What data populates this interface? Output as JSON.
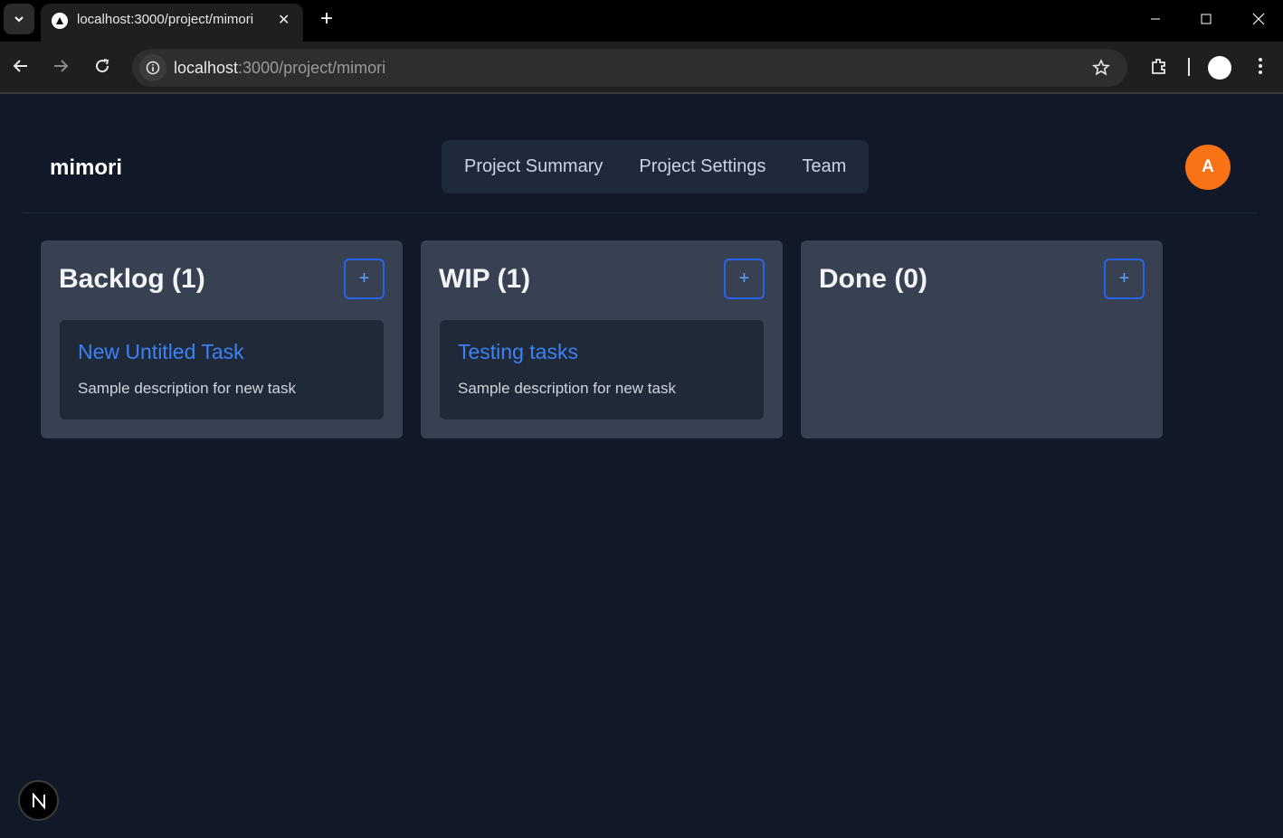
{
  "browser": {
    "tab_title": "localhost:3000/project/mimori",
    "url_host": "localhost",
    "url_path": ":3000/project/mimori"
  },
  "app": {
    "brand": "mimori",
    "nav": [
      "Project Summary",
      "Project Settings",
      "Team"
    ],
    "avatar_initial": "A",
    "avatar_color": "#f97316"
  },
  "columns": [
    {
      "title": "Backlog (1)",
      "add_label": "+",
      "cards": [
        {
          "title": "New Untitled Task",
          "description": "Sample description for new task"
        }
      ]
    },
    {
      "title": "WIP (1)",
      "add_label": "+",
      "cards": [
        {
          "title": "Testing tasks",
          "description": "Sample description for new task"
        }
      ]
    },
    {
      "title": "Done (0)",
      "add_label": "+",
      "cards": []
    }
  ],
  "icons": {
    "tab_search": "chevron-down-icon",
    "favicon": "triangle-icon",
    "next_badge": "nextjs-icon"
  }
}
